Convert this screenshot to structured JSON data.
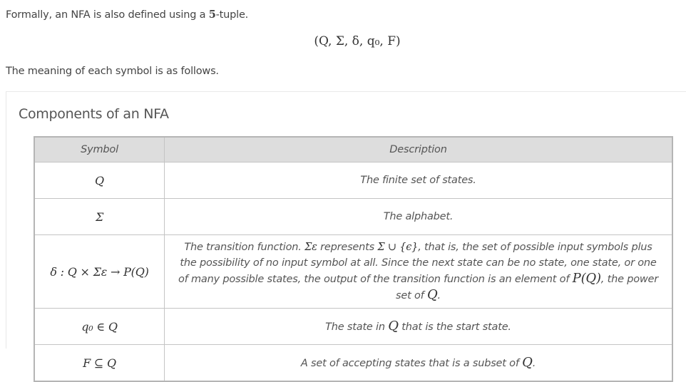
{
  "intro": {
    "pre": "Formally, an NFA is also defined using a ",
    "num": "5",
    "post": "-tuple."
  },
  "tuple": "(Q, Σ, δ, q₀, F)",
  "meaning": "The meaning of each symbol is as follows.",
  "card": {
    "title": "Components of an NFA"
  },
  "table": {
    "headers": [
      "Symbol",
      "Description"
    ],
    "rows": [
      {
        "symbol": "Q",
        "desc": "The finite set of states."
      },
      {
        "symbol": "Σ",
        "desc": "The alphabet."
      },
      {
        "symbol": "δ : Q × Σε → P(Q)",
        "desc_a": "The transition function. ",
        "m1": "Σε",
        "desc_b": " represents ",
        "m2": "Σ ∪ {ϵ}",
        "desc_c": ", that is, the set of possible input symbols plus the possibility of no input symbol at all. Since the next state can be no state, one state, or one of many possible states, the output of the transition function is an element of ",
        "m3": "P(Q)",
        "desc_d": ", the power set of ",
        "m4": "Q",
        "desc_e": "."
      },
      {
        "symbol": "q₀ ∈ Q",
        "desc_a": "The state in ",
        "m1": "Q",
        "desc_b": " that is the start state."
      },
      {
        "symbol": "F ⊆ Q",
        "desc_a": "A set of accepting states that is a subset of ",
        "m1": "Q",
        "desc_b": "."
      }
    ]
  }
}
